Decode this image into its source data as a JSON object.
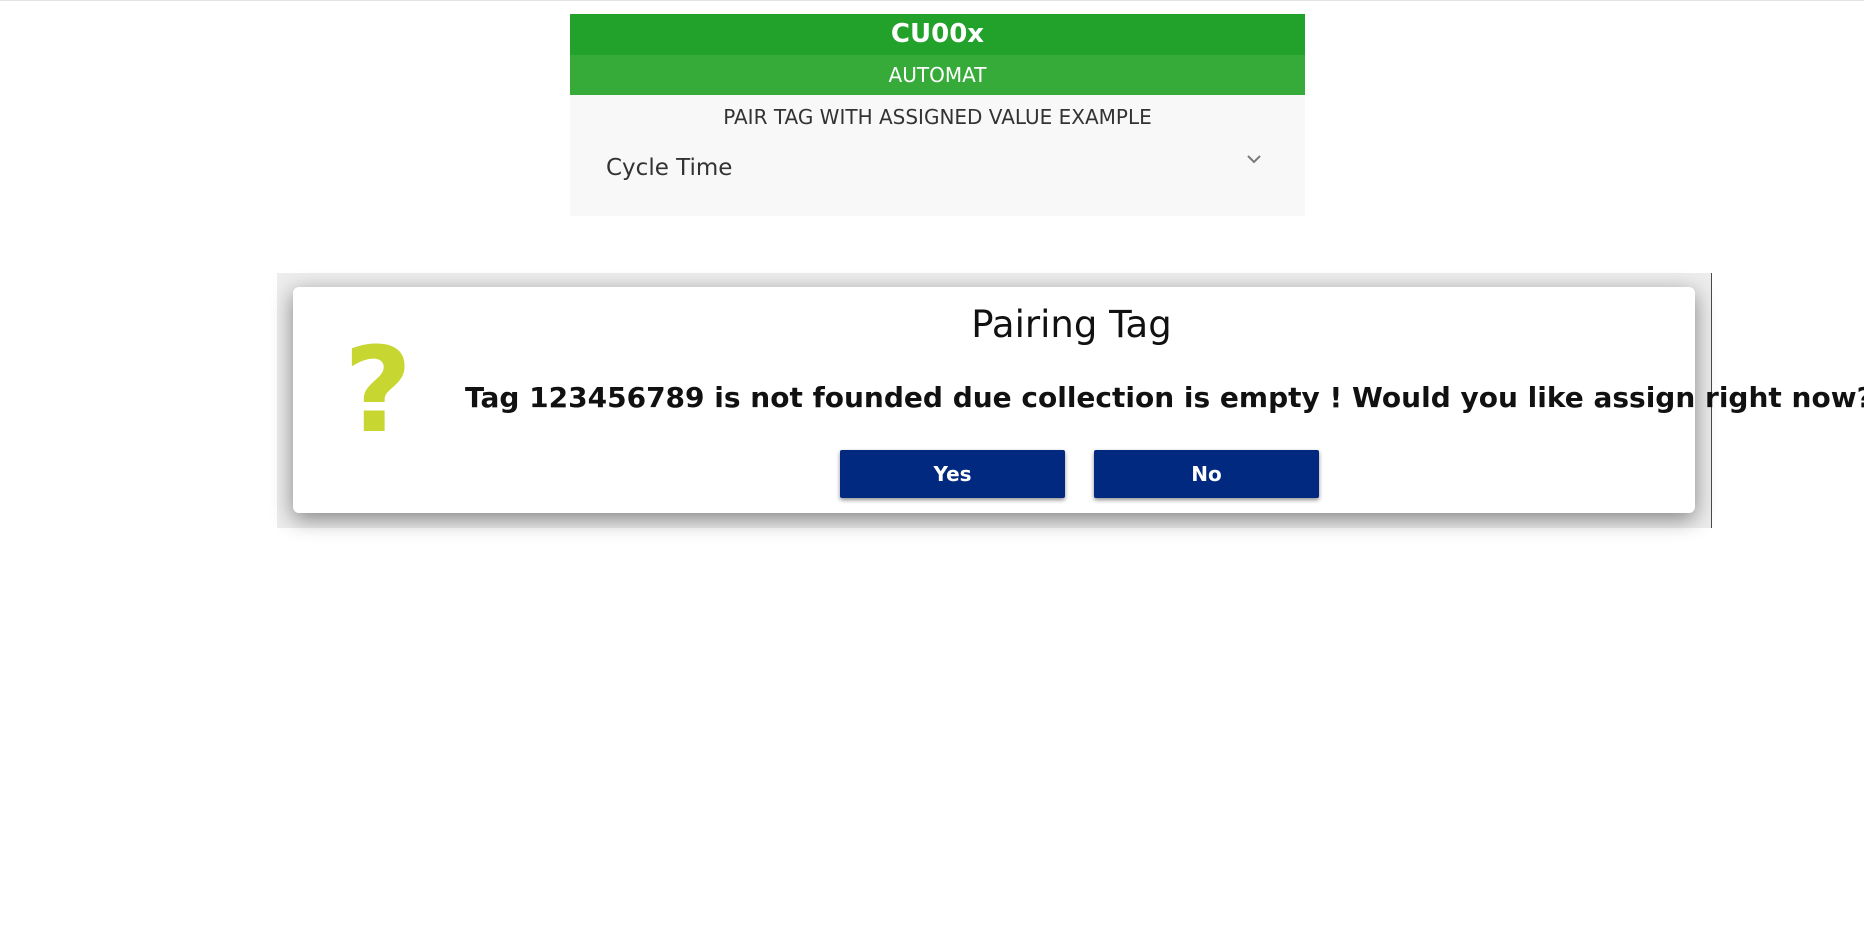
{
  "app": {
    "title": "CU00x",
    "mode": "AUTOMAT",
    "subtitle": "PAIR TAG WITH ASSIGNED VALUE EXAMPLE"
  },
  "selector": {
    "value": "Cycle Time",
    "icon": "chevron-down-icon"
  },
  "dialog": {
    "icon": "question-icon",
    "icon_glyph": "?",
    "title": "Pairing Tag",
    "message": "Tag 123456789 is not founded due collection is empty ! Would you like assign right now?",
    "yes_label": "Yes",
    "no_label": "No"
  },
  "colors": {
    "title_bar": "#22a22b",
    "mode_bar": "#37ab39",
    "panel_bg": "#f8f8f8",
    "button": "#00297f",
    "question_icon": "#c7d631"
  }
}
